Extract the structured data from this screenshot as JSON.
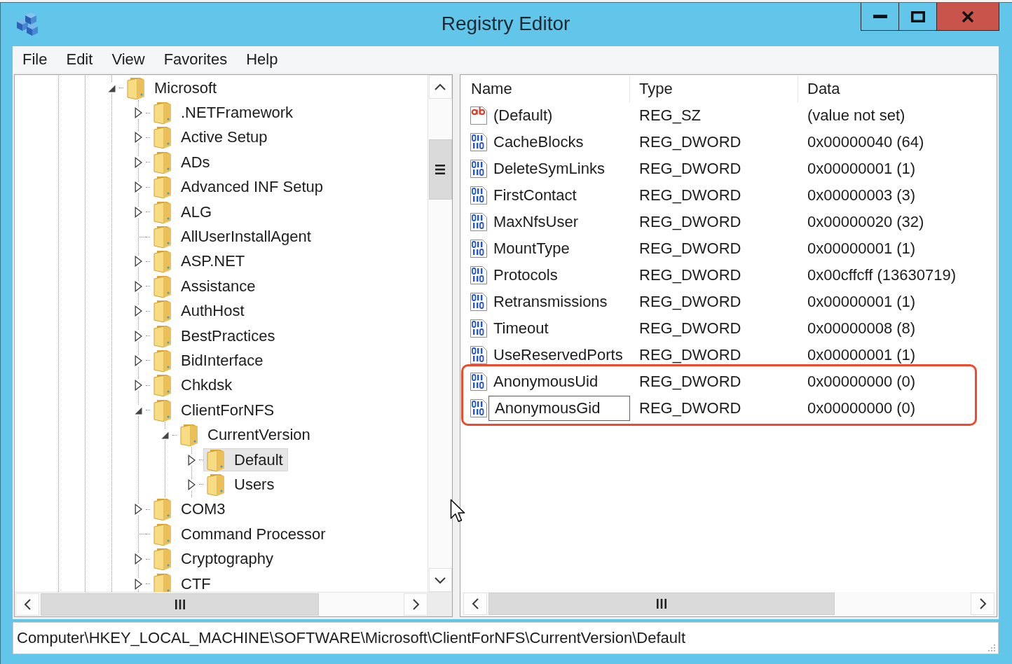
{
  "window": {
    "title": "Registry Editor"
  },
  "menu": [
    "File",
    "Edit",
    "View",
    "Favorites",
    "Help"
  ],
  "tree": {
    "items": [
      {
        "label": "Microsoft",
        "expandable": true,
        "expanded": true,
        "selected": false,
        "children": [
          {
            "label": ".NETFramework",
            "expandable": true,
            "expanded": false,
            "selected": false
          },
          {
            "label": "Active Setup",
            "expandable": true,
            "expanded": false,
            "selected": false
          },
          {
            "label": "ADs",
            "expandable": true,
            "expanded": false,
            "selected": false
          },
          {
            "label": "Advanced INF Setup",
            "expandable": true,
            "expanded": false,
            "selected": false
          },
          {
            "label": "ALG",
            "expandable": true,
            "expanded": false,
            "selected": false
          },
          {
            "label": "AllUserInstallAgent",
            "expandable": false,
            "selected": false
          },
          {
            "label": "ASP.NET",
            "expandable": true,
            "expanded": false,
            "selected": false
          },
          {
            "label": "Assistance",
            "expandable": true,
            "expanded": false,
            "selected": false
          },
          {
            "label": "AuthHost",
            "expandable": true,
            "expanded": false,
            "selected": false
          },
          {
            "label": "BestPractices",
            "expandable": true,
            "expanded": false,
            "selected": false
          },
          {
            "label": "BidInterface",
            "expandable": true,
            "expanded": false,
            "selected": false
          },
          {
            "label": "Chkdsk",
            "expandable": true,
            "expanded": false,
            "selected": false
          },
          {
            "label": "ClientForNFS",
            "expandable": true,
            "expanded": true,
            "selected": false,
            "children": [
              {
                "label": "CurrentVersion",
                "expandable": true,
                "expanded": true,
                "selected": false,
                "children": [
                  {
                    "label": "Default",
                    "expandable": true,
                    "expanded": false,
                    "selected": true
                  },
                  {
                    "label": "Users",
                    "expandable": true,
                    "expanded": false,
                    "selected": false
                  }
                ]
              }
            ]
          },
          {
            "label": "COM3",
            "expandable": true,
            "expanded": false,
            "selected": false
          },
          {
            "label": "Command Processor",
            "expandable": false,
            "selected": false
          },
          {
            "label": "Cryptography",
            "expandable": true,
            "expanded": false,
            "selected": false
          },
          {
            "label": "CTF",
            "expandable": true,
            "expanded": false,
            "selected": false
          }
        ]
      }
    ]
  },
  "values": {
    "columns": [
      {
        "label": "Name"
      },
      {
        "label": "Type"
      },
      {
        "label": "Data"
      }
    ],
    "rows": [
      {
        "kind": "string",
        "name": "(Default)",
        "type": "REG_SZ",
        "data": "(value not set)",
        "highlighted": false,
        "editing": false
      },
      {
        "kind": "dword",
        "name": "CacheBlocks",
        "type": "REG_DWORD",
        "data": "0x00000040 (64)",
        "highlighted": false,
        "editing": false
      },
      {
        "kind": "dword",
        "name": "DeleteSymLinks",
        "type": "REG_DWORD",
        "data": "0x00000001 (1)",
        "highlighted": false,
        "editing": false
      },
      {
        "kind": "dword",
        "name": "FirstContact",
        "type": "REG_DWORD",
        "data": "0x00000003 (3)",
        "highlighted": false,
        "editing": false
      },
      {
        "kind": "dword",
        "name": "MaxNfsUser",
        "type": "REG_DWORD",
        "data": "0x00000020 (32)",
        "highlighted": false,
        "editing": false
      },
      {
        "kind": "dword",
        "name": "MountType",
        "type": "REG_DWORD",
        "data": "0x00000001 (1)",
        "highlighted": false,
        "editing": false
      },
      {
        "kind": "dword",
        "name": "Protocols",
        "type": "REG_DWORD",
        "data": "0x00cffcff (13630719)",
        "highlighted": false,
        "editing": false
      },
      {
        "kind": "dword",
        "name": "Retransmissions",
        "type": "REG_DWORD",
        "data": "0x00000001 (1)",
        "highlighted": false,
        "editing": false
      },
      {
        "kind": "dword",
        "name": "Timeout",
        "type": "REG_DWORD",
        "data": "0x00000008 (8)",
        "highlighted": false,
        "editing": false
      },
      {
        "kind": "dword",
        "name": "UseReservedPorts",
        "type": "REG_DWORD",
        "data": "0x00000001 (1)",
        "highlighted": false,
        "editing": false
      },
      {
        "kind": "dword",
        "name": "AnonymousUid",
        "type": "REG_DWORD",
        "data": "0x00000000 (0)",
        "highlighted": true,
        "editing": false
      },
      {
        "kind": "dword",
        "name": "AnonymousGid",
        "type": "REG_DWORD",
        "data": "0x00000000 (0)",
        "highlighted": true,
        "editing": true
      }
    ]
  },
  "status_bar": {
    "path": "Computer\\HKEY_LOCAL_MACHINE\\SOFTWARE\\Microsoft\\ClientForNFS\\CurrentVersion\\Default"
  }
}
